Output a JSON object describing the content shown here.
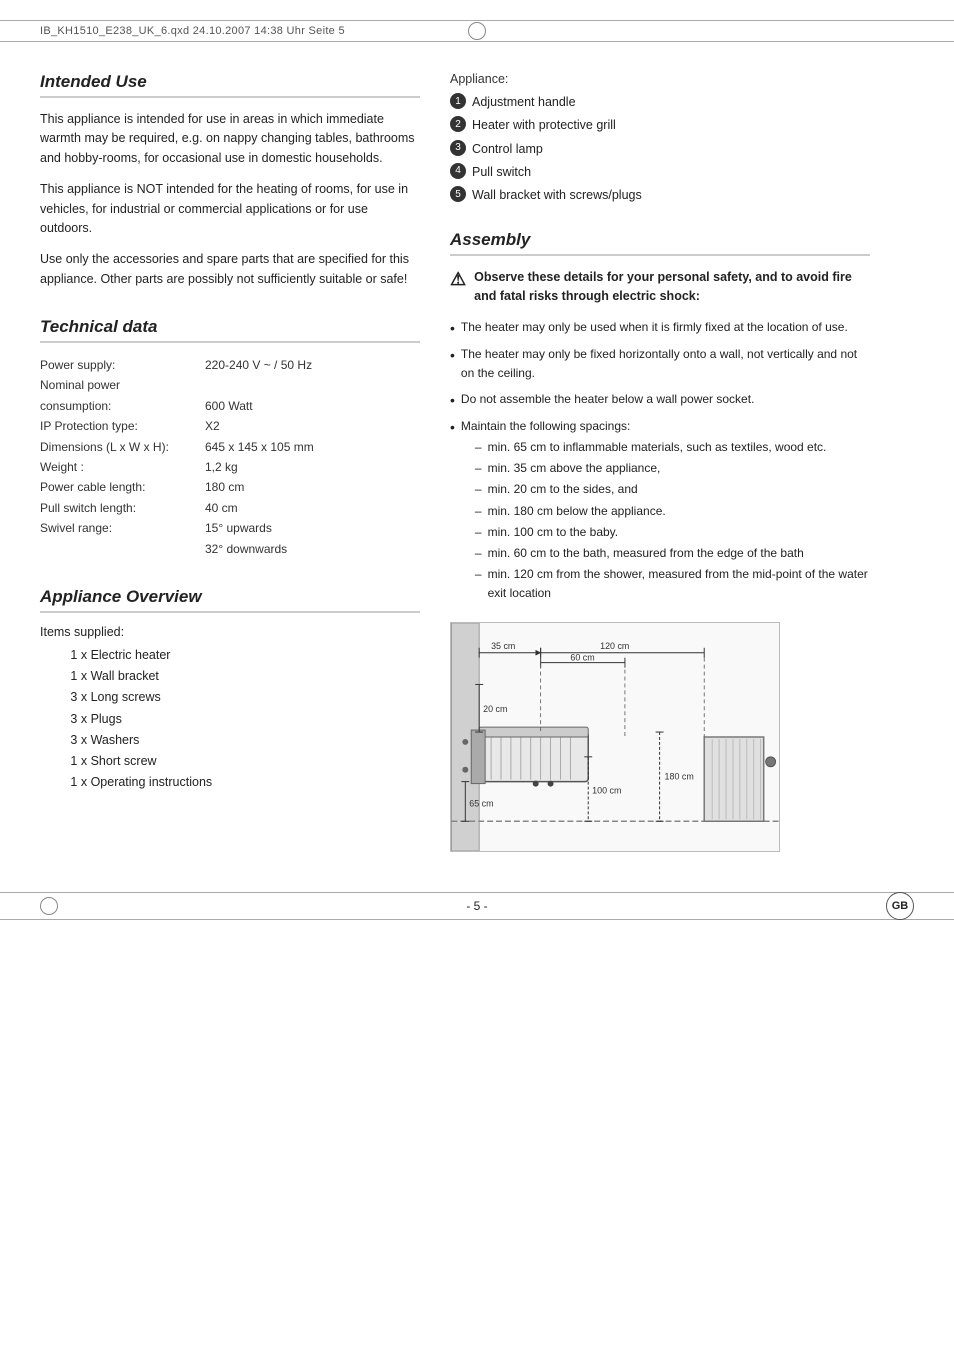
{
  "topbar": {
    "text": "IB_KH1510_E238_UK_6.qxd   24.10.2007   14:38 Uhr   Seite 5"
  },
  "intended_use": {
    "title": "Intended Use",
    "paragraphs": [
      "This appliance is intended for use in areas in which immediate warmth may be required, e.g. on nappy changing tables, bathrooms and hobby-rooms, for occasional use in domestic households.",
      "This appliance is NOT intended for the heating of rooms, for use in vehicles, for industrial or commercial applications or for use outdoors.",
      "Use only the accessories and spare parts that are specified for this appliance. Other parts are possibly not sufficiently suitable or safe!"
    ]
  },
  "technical_data": {
    "title": "Technical data",
    "rows": [
      {
        "label": "Power supply:",
        "value": "220-240 V ~ / 50 Hz"
      },
      {
        "label": "Nominal power",
        "value": ""
      },
      {
        "label": "consumption:",
        "value": "600 Watt"
      },
      {
        "label": "IP Protection type:",
        "value": "X2"
      },
      {
        "label": "Dimensions (L x W x H):",
        "value": "645 x 145 x 105 mm"
      },
      {
        "label": "Weight :",
        "value": "1,2 kg"
      },
      {
        "label": "Power cable length:",
        "value": "180 cm"
      },
      {
        "label": "Pull switch length:",
        "value": "40 cm"
      },
      {
        "label": "Swivel range:",
        "value": "15° upwards"
      },
      {
        "label": "",
        "value": "32° downwards"
      }
    ]
  },
  "appliance_overview": {
    "title": "Appliance Overview",
    "items_label": "Items supplied:",
    "items": [
      "1 x Electric heater",
      "1 x Wall bracket",
      "3 x Long screws",
      "3 x Plugs",
      "3 x Washers",
      "1 x Short screw",
      "1 x Operating instructions"
    ]
  },
  "appliance_right": {
    "label": "Appliance:",
    "numbered_items": [
      "Adjustment handle",
      "Heater with protective grill",
      "Control lamp",
      "Pull switch",
      "Wall bracket with screws/plugs"
    ]
  },
  "assembly": {
    "title": "Assembly",
    "warning": "Observe these details for your personal safety, and to avoid fire and fatal risks through electric shock:",
    "bullets": [
      {
        "text": "The heater may only be used when it is firmly fixed at the location of use.",
        "subs": []
      },
      {
        "text": "The heater may only be fixed horizontally onto a wall, not vertically and not on the ceiling.",
        "subs": []
      },
      {
        "text": "Do not assemble the heater below a wall power socket.",
        "subs": []
      },
      {
        "text": "Maintain the following spacings:",
        "subs": [
          "min. 65 cm to inflammable materials, such as textiles, wood etc.",
          "min. 35 cm above the appliance,",
          "min. 20 cm to the sides, and",
          "min. 180 cm below the appliance.",
          "min. 100 cm to the baby.",
          "min. 60 cm to the bath, measured from the edge of the bath",
          "min. 120 cm from the shower, measured from the mid-point of the water exit location"
        ]
      }
    ]
  },
  "diagram": {
    "measurements": {
      "top_left": "35 cm",
      "top_right": "120 cm",
      "left": "20 cm",
      "center": "60 cm",
      "bottom_left": "65 cm",
      "bottom_center": "100 cm",
      "bottom_right": "180 cm"
    }
  },
  "footer": {
    "page": "- 5 -",
    "country": "GB"
  }
}
